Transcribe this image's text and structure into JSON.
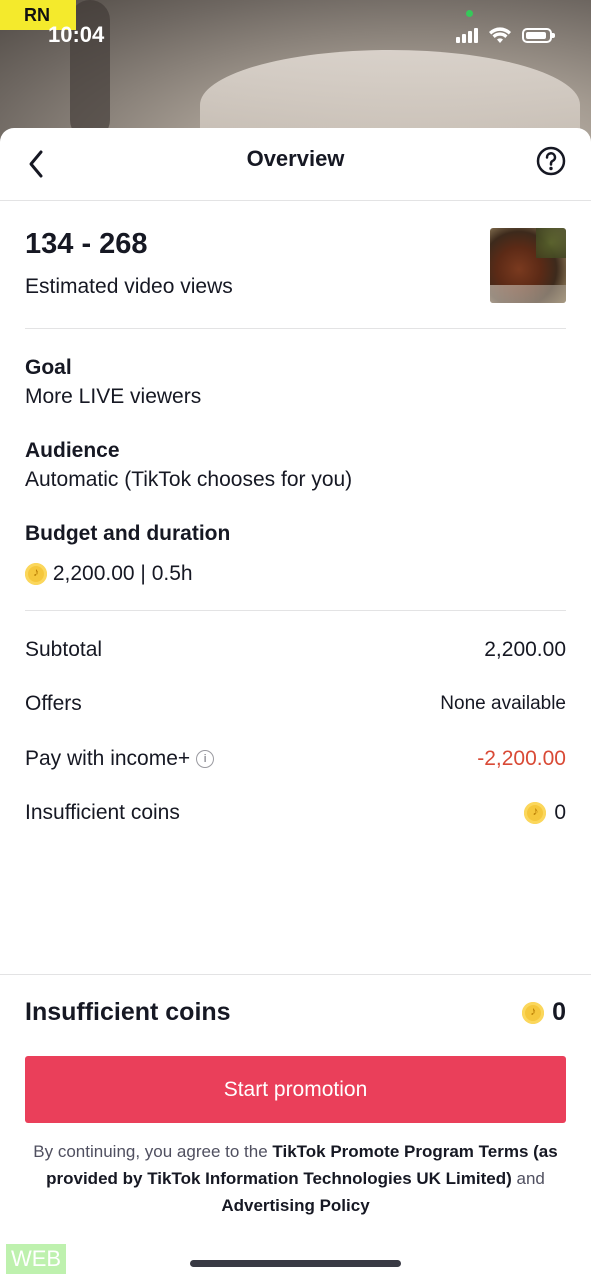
{
  "status_bar": {
    "badge": "RN",
    "time": "10:04"
  },
  "nav": {
    "title": "Overview",
    "back_icon": "chevron-left-icon",
    "help_icon": "question-circle-icon"
  },
  "estimate": {
    "range": "134 - 268",
    "label": "Estimated video views"
  },
  "goal": {
    "label": "Goal",
    "value": "More LIVE viewers"
  },
  "audience": {
    "label": "Audience",
    "value": "Automatic (TikTok chooses for you)"
  },
  "budget": {
    "label": "Budget and duration",
    "value": "2,200.00 | 0.5h"
  },
  "summary": {
    "subtotal_label": "Subtotal",
    "subtotal_value": "2,200.00",
    "offers_label": "Offers",
    "offers_value": "None available",
    "income_label": "Pay with income+",
    "income_value": "-2,200.00",
    "insufficient_label": "Insufficient coins",
    "insufficient_value": "0"
  },
  "footer": {
    "insufficient_label": "Insufficient coins",
    "insufficient_value": "0",
    "button_label": "Start promotion",
    "terms_prefix": "By continuing, you agree to the ",
    "terms_link": "TikTok Promote Program Terms (as provided by TikTok Information Technologies UK Limited)",
    "terms_and": " and ",
    "policy_link": "Advertising Policy"
  },
  "web_badge": "WEB",
  "colors": {
    "accent": "#ea3f5a",
    "negative": "#d94a36",
    "coin": "#f5c73c"
  }
}
